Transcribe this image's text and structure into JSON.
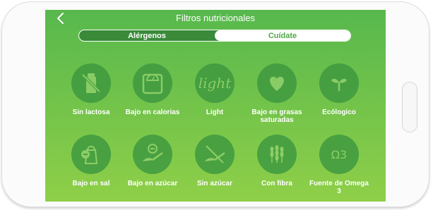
{
  "header": {
    "title": "Filtros nutricionales"
  },
  "segments": {
    "left": "Alérgenos",
    "right": "Cuídate",
    "selected": "Cuídate"
  },
  "filters": [
    {
      "label": "Sin lactosa",
      "icon": "no-milk-bottle-icon"
    },
    {
      "label": "Bajo en calorias",
      "icon": "scale-icon"
    },
    {
      "label": "Light",
      "icon": "light-text-icon",
      "icon_text": "light"
    },
    {
      "label": "Bajo en grasas saturadas",
      "icon": "heart-icon"
    },
    {
      "label": "Ecólogico",
      "icon": "sprout-icon"
    },
    {
      "label": "Bajo en sal",
      "icon": "salt-shaker-icon"
    },
    {
      "label": "Bajo en azúcar",
      "icon": "sugar-spoon-icon"
    },
    {
      "label": "Sin azúcar",
      "icon": "no-sugar-icon"
    },
    {
      "label": "Con fibra",
      "icon": "wheat-icon"
    },
    {
      "label": "Fuente de Omega 3",
      "icon": "omega3-icon",
      "icon_text": "Ω3"
    }
  ],
  "colors": {
    "gradient_top": "#57b84d",
    "gradient_bottom": "#8fcf48",
    "circle": "#3f9a40",
    "icon": "#8fcf6a"
  }
}
